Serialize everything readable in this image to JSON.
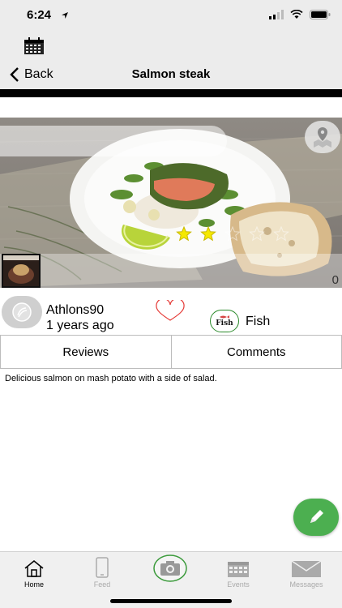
{
  "status_bar": {
    "time": "6:24"
  },
  "nav": {
    "back_label": "Back",
    "title": "Salmon steak"
  },
  "photo": {
    "count": "0",
    "rating_stars": 2,
    "rating_max": 5
  },
  "post": {
    "username": "Athlons90",
    "time_ago": "1 years ago",
    "category_badge": "Fish",
    "category": "Fish",
    "description": "Delicious salmon on mash potato with a side of salad."
  },
  "tabs": {
    "reviews": "Reviews",
    "comments": "Comments"
  },
  "tab_bar": {
    "home": "Home",
    "feed": "Feed",
    "events": "Events",
    "messages": "Messages"
  },
  "colors": {
    "accent_green": "#4caf50",
    "heart_red": "#e53935",
    "star_yellow": "#f5e800"
  }
}
